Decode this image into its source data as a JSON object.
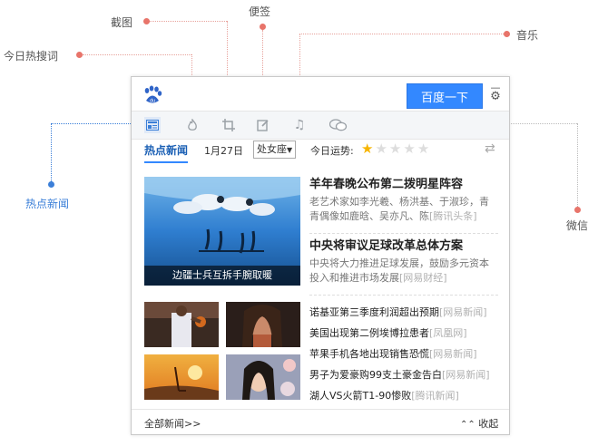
{
  "callouts": {
    "jietu": "截图",
    "bianqian": "便签",
    "yinyue": "音乐",
    "jinri": "今日热搜词",
    "redian": "热点新闻",
    "weixin": "微信"
  },
  "widget": {
    "search_button": "百度一下",
    "tabs": {
      "active": "热点新闻"
    },
    "date": "1月27日",
    "horoscope": {
      "selected": "处女座"
    },
    "fortune_label": "今日运势:",
    "rating": 1,
    "hero": {
      "caption": "边疆士兵互拆手腕取暖"
    },
    "headlines": [
      {
        "title": "羊年春晚公布第二拨明星阵容",
        "desc": "老艺术家如李光羲、杨洪基、于淑珍，青青偶像如鹿晗、吴亦凡、陈",
        "source": "[腾讯头条]"
      },
      {
        "title": "中央将审议足球改革总体方案",
        "desc": "中央将大力推进足球发展，鼓励多元资本投入和推进市场发展",
        "source": "[网易财经]"
      }
    ],
    "list": [
      {
        "text": "诺基亚第三季度利润超出预期",
        "source": "[网易新闻]"
      },
      {
        "text": "美国出现第二例埃博拉患者",
        "source": "[凤凰网]"
      },
      {
        "text": "苹果手机各地出现销售恐慌",
        "source": "[网易新闻]"
      },
      {
        "text": "男子为爱豪购99支土豪金告白",
        "source": "[网易新闻]"
      },
      {
        "text": "湖人VS火箭T1-90惨败",
        "source": "[腾讯新闻]"
      }
    ],
    "footer": {
      "all_news": "全部新闻>>",
      "collapse": "收起"
    }
  },
  "colors": {
    "accent": "#3388ff",
    "callout_dot": "#e8746a",
    "callout_blue": "#3b7fd8"
  }
}
